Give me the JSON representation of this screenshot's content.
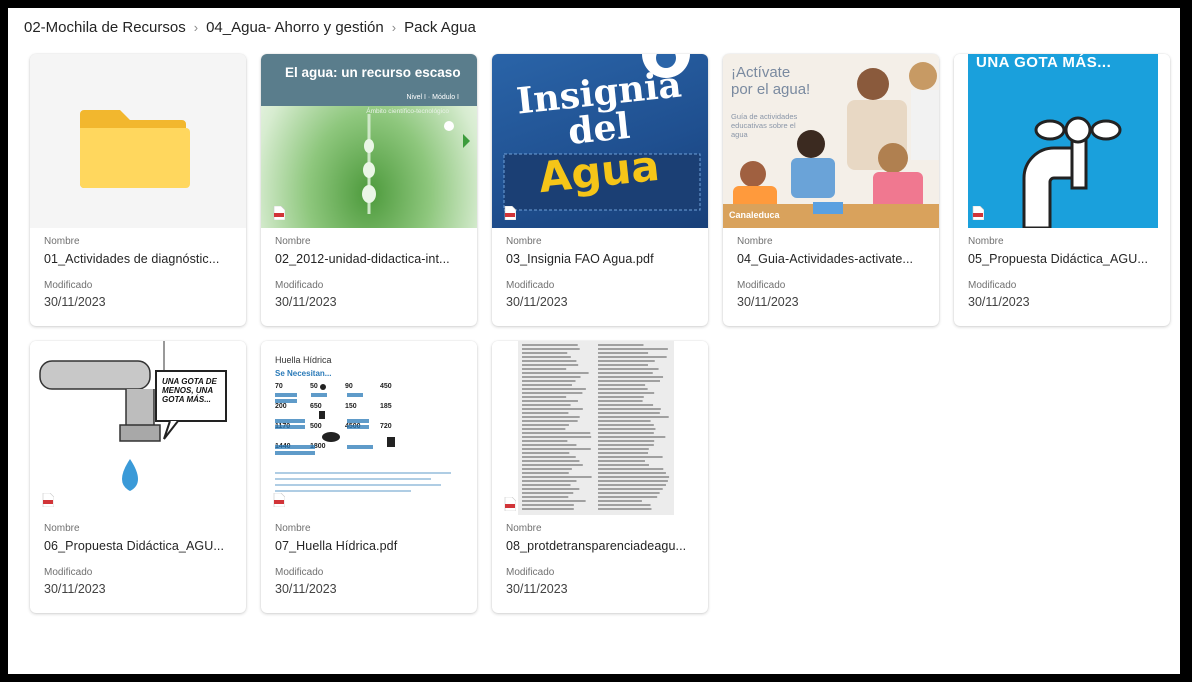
{
  "breadcrumb": {
    "items": [
      "02-Mochila de Recursos",
      "04_Agua- Ahorro y gestión",
      "Pack Agua"
    ]
  },
  "labels": {
    "name": "Nombre",
    "modified": "Modificado"
  },
  "files": [
    {
      "name": "01_Actividades de diagnóstic...",
      "modified": "30/11/2023",
      "kind": "folder"
    },
    {
      "name": "02_2012-unidad-didactica-int...",
      "modified": "30/11/2023",
      "kind": "pdf",
      "thumb_title": "El agua: un recurso escaso",
      "thumb_sub1": "Nivel I · Módulo I",
      "thumb_sub2": "Ámbito científico-tecnológico"
    },
    {
      "name": "03_Insignia FAO Agua.pdf",
      "modified": "30/11/2023",
      "kind": "pdf",
      "thumb_l1": "Insignia",
      "thumb_l2": "del",
      "thumb_l3": "Agua"
    },
    {
      "name": "04_Guia-Actividades-activate...",
      "modified": "30/11/2023",
      "kind": "pdf",
      "thumb_l1": "¡Actívate",
      "thumb_l2": "por el agua!",
      "thumb_l3": "Guía de actividades educativas sobre el agua",
      "thumb_brand": "Canaleduca"
    },
    {
      "name": "05_Propuesta Didáctica_AGU...",
      "modified": "30/11/2023",
      "kind": "pdf",
      "thumb_title": "UNA GOTA MÁS..."
    },
    {
      "name": "06_Propuesta Didáctica_AGU...",
      "modified": "30/11/2023",
      "kind": "pdf",
      "thumb_bubble": "UNA GOTA DE MENOS, UNA GOTA MÁS..."
    },
    {
      "name": "07_Huella Hídrica.pdf",
      "modified": "30/11/2023",
      "kind": "pdf",
      "thumb_title": "Huella Hídrica",
      "thumb_sub": "Se Necesitan...",
      "thumb_numbers": [
        "70",
        "50",
        "90",
        "450",
        "200",
        "650",
        "150",
        "185",
        "1170",
        "500",
        "4500",
        "720",
        "1440",
        "1800"
      ]
    },
    {
      "name": "08_protdetransparenciadeagu...",
      "modified": "30/11/2023",
      "kind": "pdf"
    }
  ],
  "colors": {
    "card_border": "#e1e1e1",
    "folder": "#ffd75e",
    "folder_tab": "#f2b72e",
    "pdf_red": "#d13438"
  }
}
